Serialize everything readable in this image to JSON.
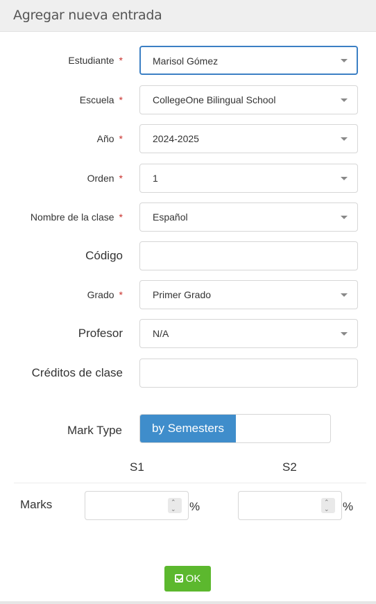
{
  "header": {
    "title": "Agregar nueva entrada"
  },
  "form": {
    "required_mark": "*",
    "estudiante": {
      "label": "Estudiante",
      "value": "Marisol Gómez"
    },
    "escuela": {
      "label": "Escuela",
      "value": "CollegeOne Bilingual School"
    },
    "anio": {
      "label": "Año",
      "value": "2024-2025"
    },
    "orden": {
      "label": "Orden",
      "value": "1"
    },
    "nombre_clase": {
      "label": "Nombre de la clase",
      "value": "Español"
    },
    "codigo": {
      "label": "Código",
      "value": ""
    },
    "grado": {
      "label": "Grado",
      "value": "Primer Grado"
    },
    "profesor": {
      "label": "Profesor",
      "value": "N/A"
    },
    "creditos": {
      "label": "Créditos de clase",
      "value": ""
    }
  },
  "mark_type": {
    "label": "Mark Type",
    "selected": "by Semesters"
  },
  "marks": {
    "label": "Marks",
    "columns": [
      "S1",
      "S2"
    ],
    "s1_value": "",
    "s2_value": "",
    "unit": "%"
  },
  "actions": {
    "ok_label": "OK"
  },
  "colors": {
    "primary": "#3f8dcb",
    "success": "#5cb82e",
    "required": "#c9302c"
  }
}
